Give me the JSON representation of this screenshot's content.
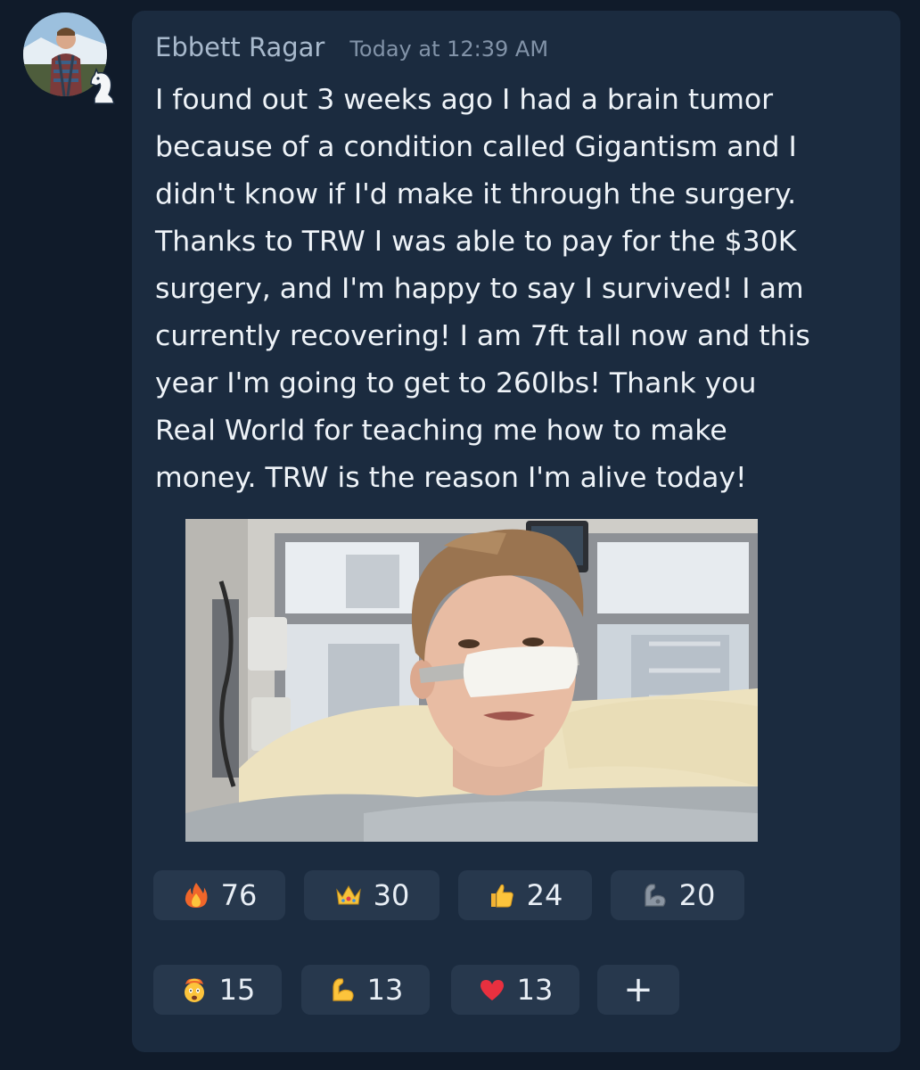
{
  "message": {
    "author": "Ebbett Ragar",
    "timestamp": "Today at 12:39 AM",
    "lines": [
      "I found out 3 weeks ago I had a brain tumor",
      "because of a condition called Gigantism and I",
      "didn't know if I'd make it through the surgery.",
      "Thanks to TRW I was able to pay for the $30K",
      "surgery, and I'm happy to say I survived! I am",
      "currently recovering! I am 7ft tall now and this",
      "year I'm going to get to 260lbs! Thank you",
      "Real World for teaching me how to make",
      "money. TRW is the reason I'm alive today!"
    ]
  },
  "avatar": {
    "icon": "avatar-photo",
    "badge_icon": "knight-chess-icon"
  },
  "attachment": {
    "icon": "hospital-selfie-photo"
  },
  "reactions": [
    {
      "icon": "fire-icon",
      "count": "76"
    },
    {
      "icon": "crown-icon",
      "count": "30"
    },
    {
      "icon": "thumbs-up-icon",
      "count": "24"
    },
    {
      "icon": "mechanical-arm-icon",
      "count": "20"
    },
    {
      "icon": "exploding-head-icon",
      "count": "15"
    },
    {
      "icon": "flexed-biceps-icon",
      "count": "13"
    },
    {
      "icon": "red-heart-icon",
      "count": "13"
    }
  ],
  "add_reaction": {
    "label": "+",
    "icon": "plus-icon"
  },
  "colors": {
    "background": "#101b2a",
    "card": "#1b2b3f",
    "reaction_button": "#27384d",
    "text": "#eef3f8",
    "username": "#a8b9cc"
  }
}
